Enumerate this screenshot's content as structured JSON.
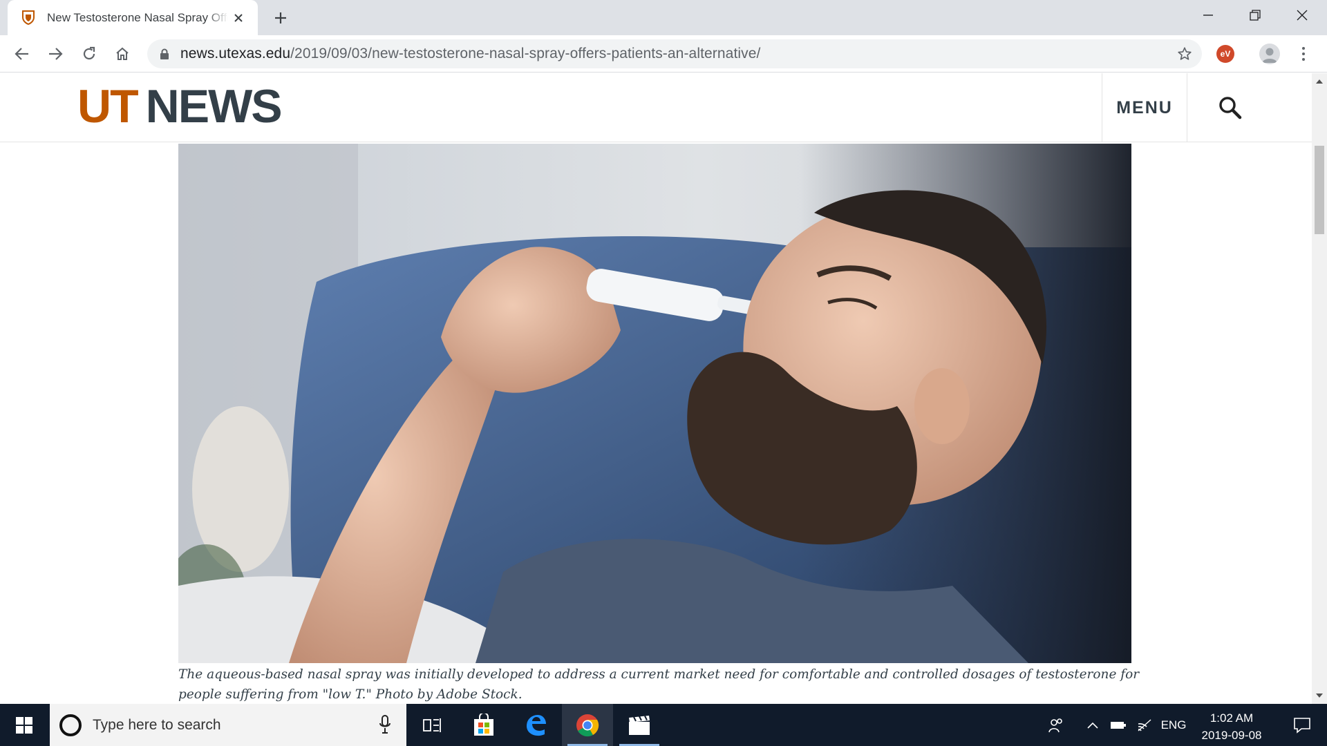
{
  "browser": {
    "tab_title": "New Testosterone Nasal Spray Offers Patients an Alternative",
    "url_host": "news.utexas.edu",
    "url_path": "/2019/09/03/new-testosterone-nasal-spray-offers-patients-an-alternative/",
    "extension_badge": "eV"
  },
  "site": {
    "logo_ut": "UT",
    "logo_news": "NEWS",
    "menu_label": "MENU",
    "brand_orange": "#bf5700",
    "brand_slate": "#333f48"
  },
  "article": {
    "hero_image_desc": "man with beard using nasal spray",
    "caption": "The aqueous-based nasal spray was initially developed to address a current market need for comfortable and controlled dosages of testosterone for people suffering from \"low T.\" Photo by Adobe Stock."
  },
  "taskbar": {
    "search_placeholder": "Type here to search",
    "language": "ENG",
    "time": "1:02 AM",
    "date": "2019-09-08"
  }
}
